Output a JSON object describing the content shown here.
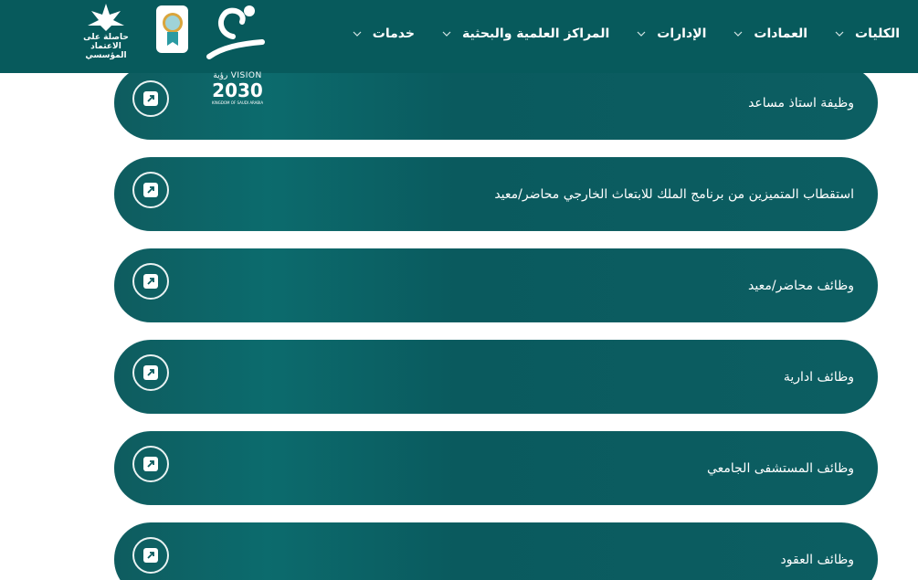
{
  "header": {
    "nav": [
      {
        "label": "الكليات"
      },
      {
        "label": "العمادات"
      },
      {
        "label": "الإدارات"
      },
      {
        "label": "المراكز العلمية والبحثية"
      },
      {
        "label": "خدمات"
      }
    ],
    "accreditation_text_1": "حاصلة على",
    "accreditation_text_2": "الاعتماد المؤسسي"
  },
  "vision": {
    "top": "VISION رؤية",
    "number": "2030",
    "sub": "KINGDOM OF SAUDI ARABIA"
  },
  "cards": [
    {
      "title": "وظيفة استاذ مساعد"
    },
    {
      "title": "استقطاب المتميزين من برنامج الملك للابتعاث الخارجي محاضر/معيد"
    },
    {
      "title": "وظائف محاضر/معيد"
    },
    {
      "title": "وظائف ادارية"
    },
    {
      "title": "وظائف المستشفى الجامعي"
    },
    {
      "title": "وظائف العقود"
    }
  ],
  "colors": {
    "header_bg": "#075a5c",
    "card_bg": "#0a5a5e",
    "text": "#ffffff"
  }
}
